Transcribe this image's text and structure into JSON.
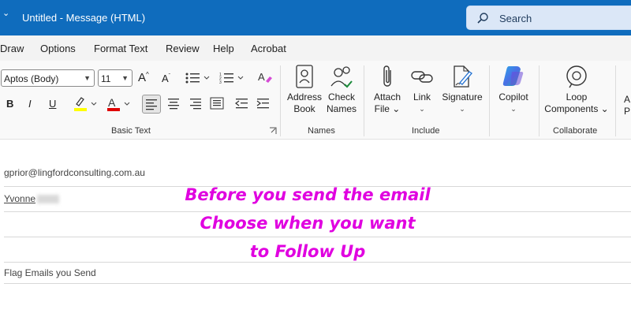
{
  "titlebar": {
    "menu_glyph": "⌄",
    "title": "Untitled  -  Message (HTML)",
    "search_placeholder": "Search"
  },
  "menubar": {
    "items": [
      "Draw",
      "Options",
      "Format Text",
      "Review",
      "Help",
      "Acrobat"
    ]
  },
  "ribbon": {
    "font_name": "Aptos (Body)",
    "font_size": "11",
    "bold": "B",
    "italic": "I",
    "underline": "U",
    "groups": {
      "basic_text": "Basic Text",
      "names": "Names",
      "include": "Include",
      "collaborate": "Collaborate"
    },
    "buttons": {
      "address_book": [
        "Address",
        "Book"
      ],
      "check_names": [
        "Check",
        "Names"
      ],
      "attach_file": [
        "Attach",
        "File ⌄"
      ],
      "link": [
        "Link",
        "⌄"
      ],
      "signature": [
        "Signature",
        "⌄"
      ],
      "copilot": [
        "Copilot",
        "⌄"
      ],
      "loop_components": [
        "Loop",
        "Components ⌄"
      ],
      "partial": [
        "A",
        "P"
      ]
    }
  },
  "message": {
    "from": "gprior@lingfordconsulting.com.au",
    "to": "Yvonne",
    "subject": "Flag Emails you Send",
    "overlay_lines": [
      "Before you send the email",
      "Choose when you want",
      "to Follow Up"
    ]
  },
  "colors": {
    "titlebar": "#0f6cbd",
    "overlay_text": "#e000e0",
    "highlight_bar": "#ffff00",
    "font_color_bar": "#e00000"
  }
}
